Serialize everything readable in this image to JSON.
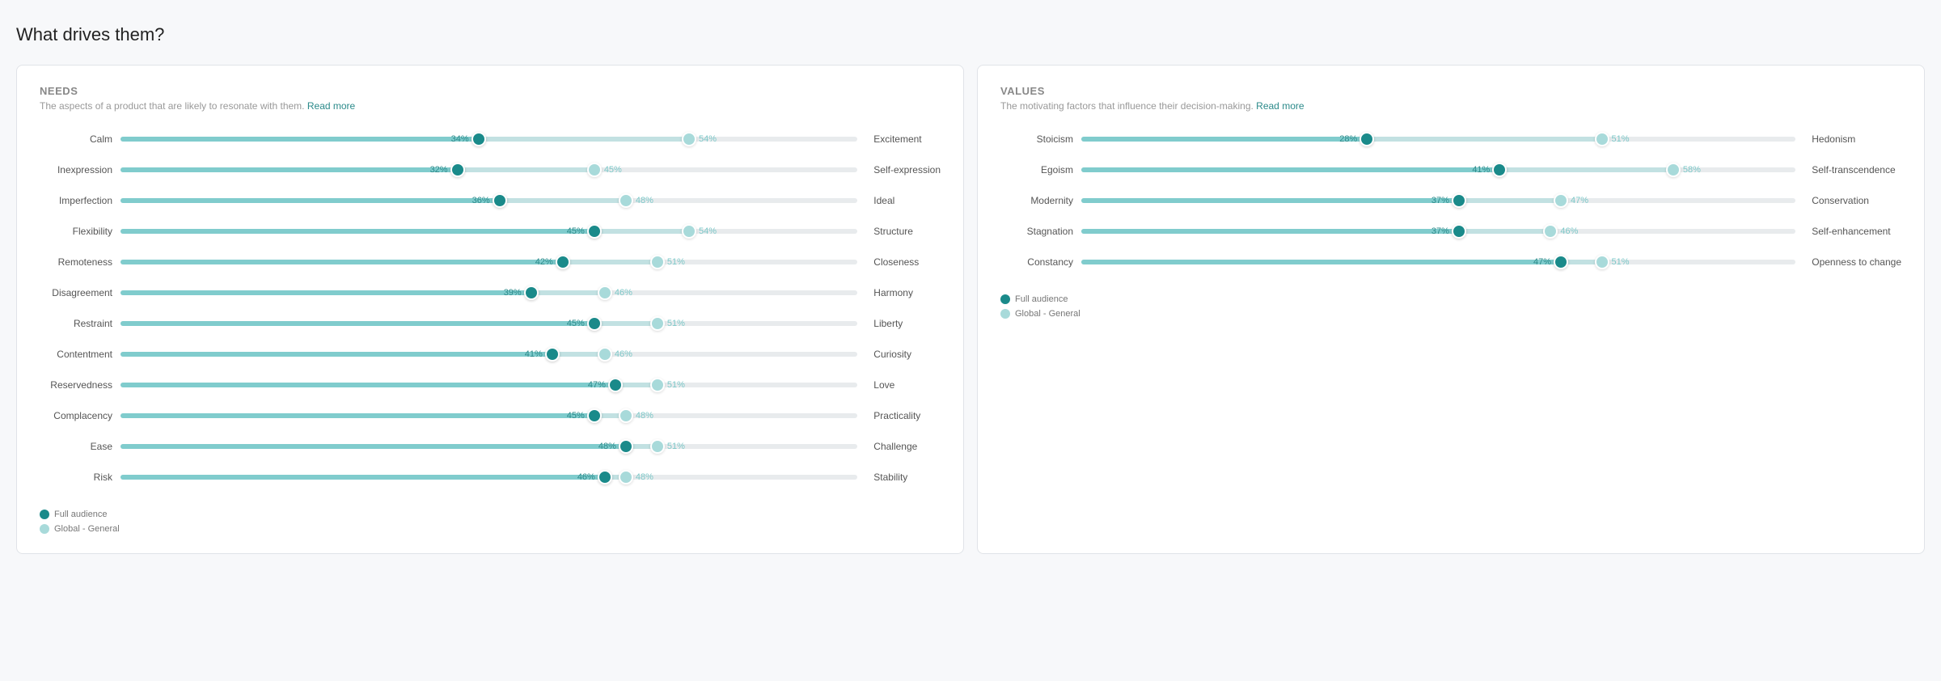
{
  "page": {
    "title": "What drives them?"
  },
  "needs_panel": {
    "title": "Needs",
    "subtitle": "The aspects of a product that are likely to resonate with them.",
    "read_more": "Read more",
    "items": [
      {
        "label": "Calm",
        "audience_pct": 34,
        "global_pct": 54,
        "opposite": "Excitement"
      },
      {
        "label": "Inexpression",
        "audience_pct": 32,
        "global_pct": 45,
        "opposite": "Self-expression"
      },
      {
        "label": "Imperfection",
        "audience_pct": 36,
        "global_pct": 48,
        "opposite": "Ideal"
      },
      {
        "label": "Flexibility",
        "audience_pct": 45,
        "global_pct": 54,
        "opposite": "Structure"
      },
      {
        "label": "Remoteness",
        "audience_pct": 42,
        "global_pct": 51,
        "opposite": "Closeness"
      },
      {
        "label": "Disagreement",
        "audience_pct": 39,
        "global_pct": 46,
        "opposite": "Harmony"
      },
      {
        "label": "Restraint",
        "audience_pct": 45,
        "global_pct": 51,
        "opposite": "Liberty"
      },
      {
        "label": "Contentment",
        "audience_pct": 41,
        "global_pct": 46,
        "opposite": "Curiosity"
      },
      {
        "label": "Reservedness",
        "audience_pct": 47,
        "global_pct": 51,
        "opposite": "Love"
      },
      {
        "label": "Complacency",
        "audience_pct": 45,
        "global_pct": 48,
        "opposite": "Practicality"
      },
      {
        "label": "Ease",
        "audience_pct": 48,
        "global_pct": 51,
        "opposite": "Challenge"
      },
      {
        "label": "Risk",
        "audience_pct": 46,
        "global_pct": 48,
        "opposite": "Stability"
      }
    ],
    "legend": {
      "audience_label": "Full audience",
      "global_label": "Global - General",
      "audience_color": "#1a8a8a",
      "global_color": "#a8dada"
    }
  },
  "values_panel": {
    "title": "Values",
    "subtitle": "The motivating factors that influence their decision-making.",
    "read_more": "Read more",
    "items": [
      {
        "label": "Stoicism",
        "audience_pct": 28,
        "global_pct": 51,
        "opposite": "Hedonism"
      },
      {
        "label": "Egoism",
        "audience_pct": 41,
        "global_pct": 58,
        "opposite": "Self-transcendence"
      },
      {
        "label": "Modernity",
        "audience_pct": 37,
        "global_pct": 47,
        "opposite": "Conservation"
      },
      {
        "label": "Stagnation",
        "audience_pct": 37,
        "global_pct": 46,
        "opposite": "Self-enhancement"
      },
      {
        "label": "Constancy",
        "audience_pct": 47,
        "global_pct": 51,
        "opposite": "Openness to change"
      }
    ],
    "legend": {
      "audience_label": "Full audience",
      "global_label": "Global - General",
      "audience_color": "#1a8a8a",
      "global_color": "#a8dada"
    }
  }
}
